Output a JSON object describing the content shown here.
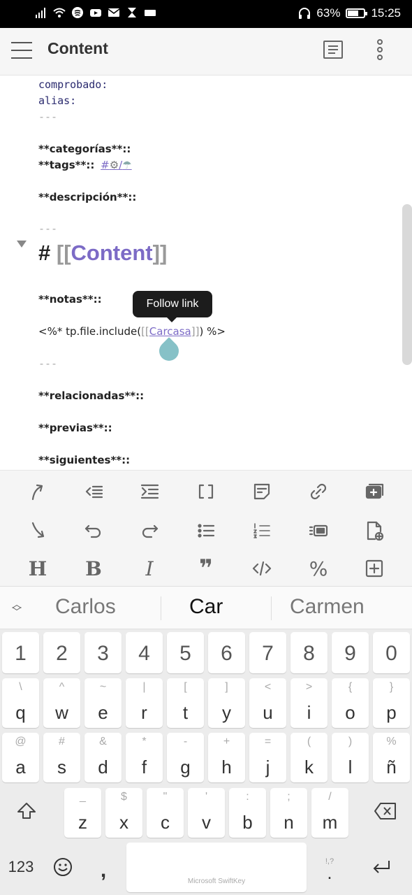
{
  "status": {
    "battery": "63%",
    "time": "15:25"
  },
  "header": {
    "title": "Content"
  },
  "editor": {
    "lines": [
      {
        "text": "comprobado:"
      },
      {
        "text": "alias:"
      },
      {
        "text": "---"
      },
      {
        "text": "**categorías**::"
      },
      {
        "text": "**tags**::"
      },
      {
        "text": "#"
      },
      {
        "text": "/"
      },
      {
        "text": "**descripción**::"
      },
      {
        "text": "---"
      },
      {
        "text": "#"
      },
      {
        "text": "[["
      },
      {
        "text": "Content"
      },
      {
        "text": "]]"
      },
      {
        "text": "**notas**::"
      },
      {
        "text": "<%* tp.file.include("
      },
      {
        "text": "[["
      },
      {
        "text": "Carcasa"
      },
      {
        "text": "]]"
      },
      {
        "text": ") %>"
      },
      {
        "text": "---"
      },
      {
        "text": "**relacionadas**::"
      },
      {
        "text": "**previas**::"
      },
      {
        "text": "**siguientes**::"
      }
    ],
    "tooltip": "Follow link"
  },
  "toolbar": {
    "icons": [
      "indent-arrow-icon",
      "outdent-icon",
      "indent-icon",
      "brackets-icon",
      "note-icon",
      "link-icon",
      "add-card-icon",
      "arrow-down-curved-icon",
      "undo-icon",
      "redo-icon",
      "bullet-list-icon",
      "numbered-list-icon",
      "template-icon",
      "new-file-icon",
      "heading-icon",
      "bold-icon",
      "italic-icon",
      "quote-icon",
      "code-icon",
      "percent-icon",
      "add-box-icon"
    ],
    "glyphs": {
      "heading": "H",
      "bold": "B",
      "italic": "I",
      "quote": "❞",
      "percent": "%"
    }
  },
  "suggestions": [
    "Carlos",
    "Car",
    "Carmen"
  ],
  "keyboard": {
    "numbers": [
      "1",
      "2",
      "3",
      "4",
      "5",
      "6",
      "7",
      "8",
      "9",
      "0"
    ],
    "row1": [
      {
        "pri": "q",
        "sec": "\\"
      },
      {
        "pri": "w",
        "sec": "^"
      },
      {
        "pri": "e",
        "sec": "~"
      },
      {
        "pri": "r",
        "sec": "|"
      },
      {
        "pri": "t",
        "sec": "["
      },
      {
        "pri": "y",
        "sec": "]"
      },
      {
        "pri": "u",
        "sec": "<"
      },
      {
        "pri": "i",
        "sec": ">"
      },
      {
        "pri": "o",
        "sec": "{"
      },
      {
        "pri": "p",
        "sec": "}"
      }
    ],
    "row2": [
      {
        "pri": "a",
        "sec": "@"
      },
      {
        "pri": "s",
        "sec": "#"
      },
      {
        "pri": "d",
        "sec": "&"
      },
      {
        "pri": "f",
        "sec": "*"
      },
      {
        "pri": "g",
        "sec": "-"
      },
      {
        "pri": "h",
        "sec": "+"
      },
      {
        "pri": "j",
        "sec": "="
      },
      {
        "pri": "k",
        "sec": "("
      },
      {
        "pri": "l",
        "sec": ")"
      },
      {
        "pri": "ñ",
        "sec": "%"
      }
    ],
    "row3": [
      {
        "pri": "z",
        "sec": "_"
      },
      {
        "pri": "x",
        "sec": "$"
      },
      {
        "pri": "c",
        "sec": "\""
      },
      {
        "pri": "v",
        "sec": "'"
      },
      {
        "pri": "b",
        "sec": ":"
      },
      {
        "pri": "n",
        "sec": ";"
      },
      {
        "pri": "m",
        "sec": "/"
      }
    ],
    "bottom": {
      "numbers_key": "123",
      "comma": ",",
      "space_brand": "Microsoft SwiftKey",
      "period": ".",
      "period_alt": "!,?"
    }
  }
}
